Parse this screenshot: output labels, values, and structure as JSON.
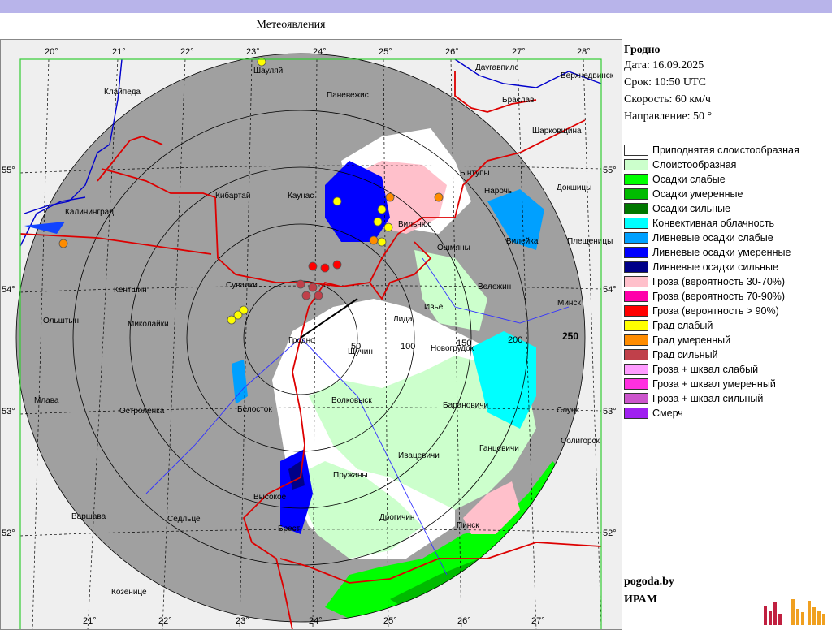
{
  "window": {
    "title": "Метеоявления"
  },
  "station": {
    "name": "Гродно",
    "date": "Дата: 16.09.2025",
    "time": "Срок: 10:50 UTC",
    "speed": "Скорость: 60  км/ч",
    "direction": "Направление:  50 °"
  },
  "legend": [
    {
      "label": "Приподнятая слоистообразная",
      "color": "#ffffff"
    },
    {
      "label": "Слоистообразная",
      "color": "#ccffcc"
    },
    {
      "label": "Осадки слабые",
      "color": "#00ff00"
    },
    {
      "label": "Осадки умеренные",
      "color": "#00bb00"
    },
    {
      "label": "Осадки сильные",
      "color": "#007700"
    },
    {
      "label": "Конвективная облачность",
      "color": "#00ffff"
    },
    {
      "label": "Ливневые осадки слабые",
      "color": "#00a0ff"
    },
    {
      "label": "Ливневые осадки умеренные",
      "color": "#0000ff"
    },
    {
      "label": "Ливневые осадки сильные",
      "color": "#000088"
    },
    {
      "label": "Гроза (вероятность 30-70%)",
      "color": "#ffc0cb"
    },
    {
      "label": "Гроза (вероятность 70-90%)",
      "color": "#ff00aa"
    },
    {
      "label": "Гроза (вероятность > 90%)",
      "color": "#ff0000"
    },
    {
      "label": "Град слабый",
      "color": "#ffff00"
    },
    {
      "label": "Град умеренный",
      "color": "#ff8c00"
    },
    {
      "label": "Град сильный",
      "color": "#c0404a"
    },
    {
      "label": "Гроза + шквал слабый",
      "color": "#ff9cff"
    },
    {
      "label": "Гроза + шквал умеренный",
      "color": "#ff30e0"
    },
    {
      "label": "Гроза + шквал сильный",
      "color": "#cc55cc"
    },
    {
      "label": "Смерч",
      "color": "#a020f0"
    }
  ],
  "brand": {
    "site": "pogoda.by",
    "org": "ИРАМ"
  },
  "colors": {
    "topbar": "#b8b4ea",
    "frame": "#33cc33",
    "border": "#dd0000",
    "river": "#0000cc",
    "road": "#3333ff",
    "lake": "#1144ff",
    "radar_bg": "#a0a0a0",
    "outside": "#efefef"
  },
  "map": {
    "lon_top": [
      "20°",
      "21°",
      "22°",
      "23°",
      "24°",
      "25°",
      "26°",
      "27°",
      "28°"
    ],
    "lon_bottom": [
      "21°",
      "22°",
      "23°",
      "24°",
      "25°",
      "26°",
      "27°"
    ],
    "lat_left": [
      "55°",
      "54°",
      "53°",
      "52°"
    ],
    "lat_right": [
      "55°",
      "54°",
      "53°",
      "52°"
    ],
    "ranges": [
      "50",
      "100",
      "150",
      "200",
      "250"
    ],
    "cities": [
      "Шауляй",
      "Даугавпилс",
      "Верхнедвинск",
      "Клайпеда",
      "Паневежис",
      "Браслав",
      "Шарковщина",
      "Ынтупы",
      "Нарочь",
      "Докшицы",
      "Кибартай",
      "Каунас",
      "Калининград",
      "Вильнюс",
      "Ошмяны",
      "Вилейка",
      "Плещеницы",
      "Сувалки",
      "Кентшин",
      "Воложин",
      "Ольштын",
      "Миколайки",
      "Минск",
      "Ивье",
      "Лида",
      "Гродно",
      "Щучин",
      "Новогрудок",
      "Волковыск",
      "Млава",
      "Остроленка",
      "Белосток",
      "Барановичи",
      "Слуцк",
      "Солигорск",
      "Ивацевичи",
      "Ганцевичи",
      "Пружаны",
      "Высокое",
      "Варшава",
      "Седльце",
      "Брест",
      "Дрогичин",
      "Пинск",
      "Козенице"
    ]
  }
}
